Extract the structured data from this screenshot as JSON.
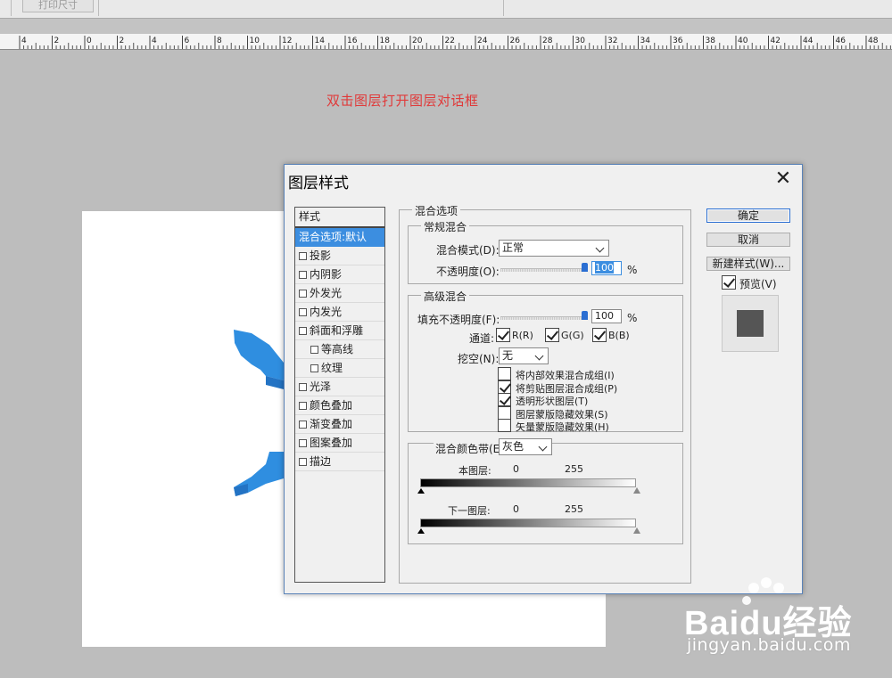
{
  "toolbar": {
    "print_size": "打印尺寸"
  },
  "ruler": {
    "labels": [
      "4",
      "2",
      "0",
      "2",
      "4",
      "6",
      "8",
      "10",
      "12",
      "14",
      "16",
      "18",
      "20",
      "22",
      "24",
      "26",
      "28",
      "30",
      "32",
      "34",
      "36",
      "38",
      "40",
      "42",
      "44",
      "46",
      "48"
    ]
  },
  "annotation": "双击图层打开图层对话框",
  "dialog": {
    "title": "图层样式",
    "styles_header": "样式",
    "styles": [
      {
        "label": "混合选项:默认",
        "checkbox": false,
        "active": true,
        "sub": false
      },
      {
        "label": "投影",
        "checkbox": true,
        "active": false,
        "sub": false
      },
      {
        "label": "内阴影",
        "checkbox": true,
        "active": false,
        "sub": false
      },
      {
        "label": "外发光",
        "checkbox": true,
        "active": false,
        "sub": false
      },
      {
        "label": "内发光",
        "checkbox": true,
        "active": false,
        "sub": false
      },
      {
        "label": "斜面和浮雕",
        "checkbox": true,
        "active": false,
        "sub": false
      },
      {
        "label": "等高线",
        "checkbox": true,
        "active": false,
        "sub": true
      },
      {
        "label": "纹理",
        "checkbox": true,
        "active": false,
        "sub": true
      },
      {
        "label": "光泽",
        "checkbox": true,
        "active": false,
        "sub": false
      },
      {
        "label": "颜色叠加",
        "checkbox": true,
        "active": false,
        "sub": false
      },
      {
        "label": "渐变叠加",
        "checkbox": true,
        "active": false,
        "sub": false
      },
      {
        "label": "图案叠加",
        "checkbox": true,
        "active": false,
        "sub": false
      },
      {
        "label": "描边",
        "checkbox": true,
        "active": false,
        "sub": false
      }
    ],
    "blend_options": {
      "title": "混合选项",
      "general": {
        "title": "常规混合",
        "mode_label": "混合模式(D):",
        "mode_value": "正常",
        "opacity_label": "不透明度(O):",
        "opacity_value": "100",
        "opacity_level": 1.0,
        "percent": "%"
      },
      "advanced": {
        "title": "高级混合",
        "fill_label": "填充不透明度(F):",
        "fill_value": "100",
        "fill_level": 1.0,
        "percent": "%",
        "channels_label": "通道:",
        "channels": [
          {
            "label": "R(R)",
            "checked": true
          },
          {
            "label": "G(G)",
            "checked": true
          },
          {
            "label": "B(B)",
            "checked": true
          }
        ],
        "knockout_label": "挖空(N):",
        "knockout_value": "无",
        "options": [
          {
            "label": "将内部效果混合成组(I)",
            "checked": false
          },
          {
            "label": "将剪贴图层混合成组(P)",
            "checked": true
          },
          {
            "label": "透明形状图层(T)",
            "checked": true
          },
          {
            "label": "图层蒙版隐藏效果(S)",
            "checked": false
          },
          {
            "label": "矢量蒙版隐藏效果(H)",
            "checked": false
          }
        ]
      },
      "blend_if": {
        "label": "混合颜色带(E):",
        "value": "灰色",
        "this_layer": "本图层:",
        "this_min": "0",
        "this_max": "255",
        "underlying": "下一图层:",
        "under_min": "0",
        "under_max": "255"
      }
    },
    "buttons": {
      "ok": "确定",
      "cancel": "取消",
      "new_style": "新建样式(W)...",
      "preview": "预览(V)",
      "preview_checked": true
    }
  },
  "watermark": {
    "brand": "Baidu经验",
    "url": "jingyan.baidu.com"
  },
  "colors": {
    "accent": "#3c8ee0",
    "annotation": "#e03a3a",
    "arrow": "#2f8ee0"
  }
}
